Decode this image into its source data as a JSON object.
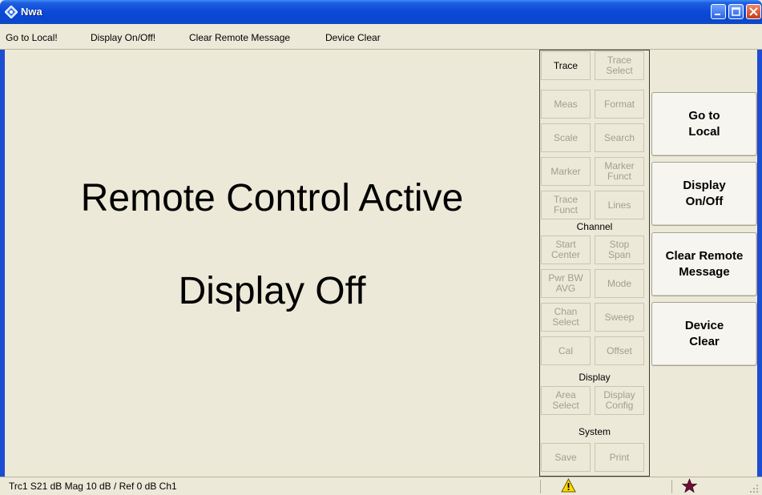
{
  "window": {
    "title": "Nwa"
  },
  "menu": {
    "items": [
      "Go to Local!",
      "Display On/Off!",
      "Clear Remote Message",
      "Device Clear"
    ]
  },
  "main": {
    "line1": "Remote Control Active",
    "line2": "Display Off"
  },
  "softkeys": {
    "trace_label": "Trace",
    "trace_select": "Trace\nSelect",
    "meas": "Meas",
    "format": "Format",
    "scale": "Scale",
    "search": "Search",
    "marker": "Marker",
    "marker_funct": "Marker\nFunct",
    "trace_funct": "Trace\nFunct",
    "lines": "Lines",
    "channel_label": "Channel",
    "start_center": "Start\nCenter",
    "stop_span": "Stop\nSpan",
    "pwr_bw_avg": "Pwr BW\nAVG",
    "mode": "Mode",
    "chan_select": "Chan\nSelect",
    "sweep": "Sweep",
    "cal": "Cal",
    "offset": "Offset",
    "display_label": "Display",
    "area_select": "Area\nSelect",
    "display_config": "Display\nConfig",
    "system_label": "System",
    "save": "Save",
    "print": "Print"
  },
  "buttons": {
    "go_to_local": "Go to\nLocal",
    "display_on_off": "Display\nOn/Off",
    "clear_remote_message": "Clear Remote\nMessage",
    "device_clear": "Device\nClear"
  },
  "status": {
    "text": "Trc1   S21   dB Mag   10 dB / Ref 0 dB   Ch1",
    "icons": [
      "warning-icon",
      "star-icon"
    ]
  },
  "colors": {
    "titlebar": "#0a48d6",
    "warning": "#ffd800",
    "star": "#6b0f3a"
  }
}
